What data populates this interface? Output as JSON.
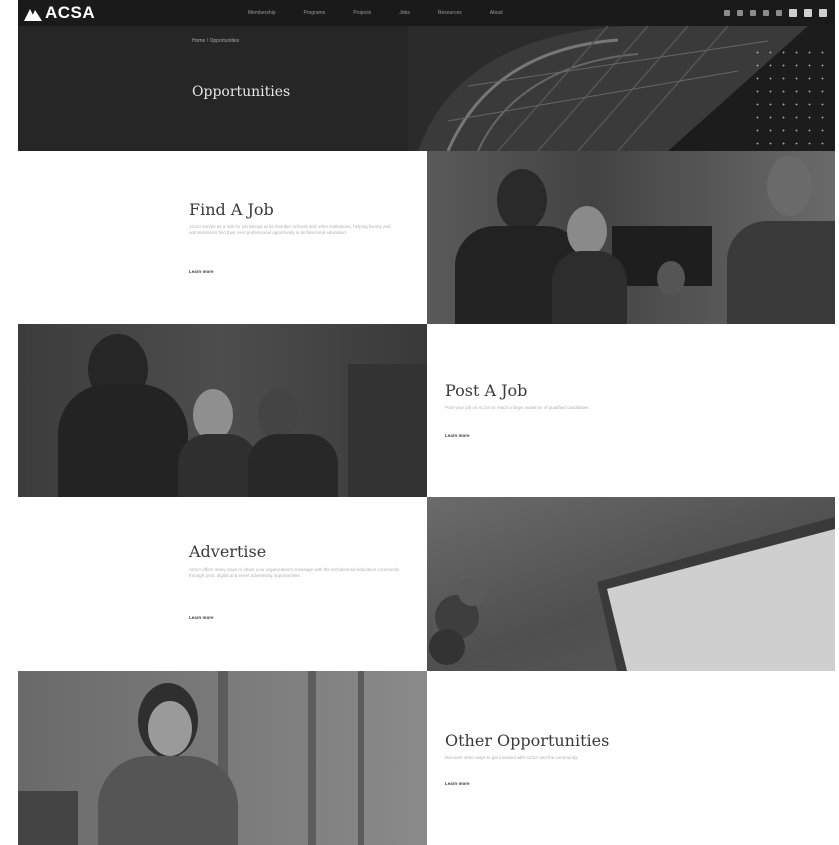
{
  "header": {
    "logo_text": "ACSA",
    "nav": [
      "Membership",
      "Programs",
      "Projects",
      "Jobs",
      "Resources",
      "About"
    ],
    "right_icons": [
      "facebook-icon",
      "twitter-icon",
      "instagram-icon",
      "youtube-icon",
      "linkedin-icon",
      "user-icon",
      "search-icon",
      "menu-icon"
    ]
  },
  "hero": {
    "breadcrumb": "Home / Opportunities",
    "title": "Opportunities"
  },
  "sections": [
    {
      "title": "Find A Job",
      "description": "ACSA serves as a hub for job listings at its member schools and other institutions, helping faculty and administrators find their next professional opportunity in architectural education.",
      "link": "Learn more"
    },
    {
      "title": "Post A Job",
      "description": "Post your job on ACSA to reach a large audience of qualified candidates.",
      "link": "Learn more"
    },
    {
      "title": "Advertise",
      "description": "ACSA offers many ways to share your organization's message with the architectural education community through print, digital and event advertising opportunities.",
      "link": "Learn more"
    },
    {
      "title": "Other Opportunities",
      "description": "Discover other ways to get involved with ACSA and the community.",
      "link": "Learn more"
    }
  ]
}
